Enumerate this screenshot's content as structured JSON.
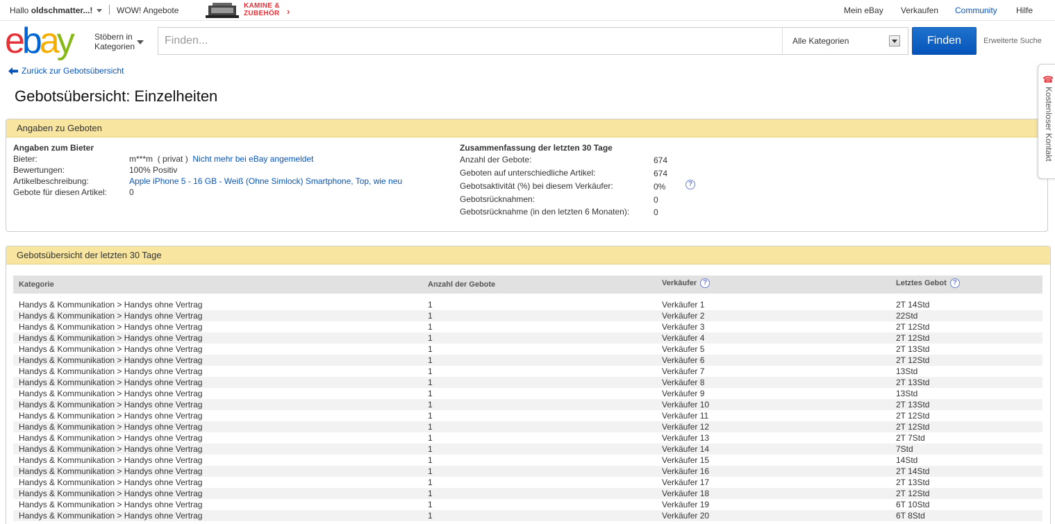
{
  "topbar": {
    "greeting_prefix": "Hallo ",
    "username": "oldschmatter...!",
    "wow": "WOW! Angebote",
    "promo_line1": "KAMINE &",
    "promo_line2": "ZUBEHÖR",
    "promo_arrow": "›",
    "my_ebay": "Mein eBay",
    "sell": "Verkaufen",
    "community": "Community",
    "help": "Hilfe"
  },
  "header": {
    "logo": [
      "e",
      "b",
      "a",
      "y"
    ],
    "logo_colors": [
      "#e53238",
      "#0064d2",
      "#f5af02",
      "#86b817"
    ],
    "browse_line1": "Stöbern in",
    "browse_line2": "Kategorien",
    "search_placeholder": "Finden...",
    "category": "Alle Kategorien",
    "find_button": "Finden",
    "advanced": "Erweiterte Suche"
  },
  "back_link": "Zurück zur Gebotsübersicht",
  "page_title": "Gebotsübersicht: Einzelheiten",
  "panel1": {
    "title": "Angaben zu Geboten",
    "bidder_header": "Angaben zum Bieter",
    "bidder_label": "Bieter:",
    "bidder_value": "m***m",
    "bidder_private": "( privat )",
    "bidder_status": "Nicht mehr bei eBay angemeldet",
    "ratings_label": "Bewertungen:",
    "ratings_value": "100% Positiv",
    "item_label": "Artikelbeschreibung:",
    "item_value": "Apple iPhone 5 - 16 GB - Weiß (Ohne Simlock) Smartphone, Top, wie neu",
    "bids_item_label": "Gebote für diesen Artikel:",
    "bids_item_value": "0",
    "summary_header": "Zusammenfassung der letzten 30 Tage",
    "summary": [
      {
        "label": "Anzahl der Gebote:",
        "value": "674"
      },
      {
        "label": "Geboten auf unterschiedliche Artikel:",
        "value": "674"
      },
      {
        "label": "Gebotsaktivität (%) bei diesem Verkäufer:",
        "value": "0%"
      },
      {
        "label": "Gebotsrücknahmen:",
        "value": "0"
      },
      {
        "label": "Gebotsrücknahme (in den letzten 6 Monaten):",
        "value": "0"
      }
    ]
  },
  "panel2": {
    "title": "Gebotsübersicht der letzten 30 Tage",
    "columns": [
      "Kategorie",
      "Anzahl der Gebote",
      "Verkäufer",
      "Letztes Gebot"
    ],
    "help_glyph": "?",
    "rows": [
      [
        "Handys & Kommunikation > Handys ohne Vertrag",
        "1",
        "Verkäufer 1",
        "2T 14Std"
      ],
      [
        "Handys & Kommunikation > Handys ohne Vertrag",
        "1",
        "Verkäufer 2",
        "22Std"
      ],
      [
        "Handys & Kommunikation > Handys ohne Vertrag",
        "1",
        "Verkäufer 3",
        "2T 12Std"
      ],
      [
        "Handys & Kommunikation > Handys ohne Vertrag",
        "1",
        "Verkäufer 4",
        "2T 12Std"
      ],
      [
        "Handys & Kommunikation > Handys ohne Vertrag",
        "1",
        "Verkäufer 5",
        "2T 13Std"
      ],
      [
        "Handys & Kommunikation > Handys ohne Vertrag",
        "1",
        "Verkäufer 6",
        "2T 12Std"
      ],
      [
        "Handys & Kommunikation > Handys ohne Vertrag",
        "1",
        "Verkäufer 7",
        "13Std"
      ],
      [
        "Handys & Kommunikation > Handys ohne Vertrag",
        "1",
        "Verkäufer 8",
        "2T 13Std"
      ],
      [
        "Handys & Kommunikation > Handys ohne Vertrag",
        "1",
        "Verkäufer 9",
        "13Std"
      ],
      [
        "Handys & Kommunikation > Handys ohne Vertrag",
        "1",
        "Verkäufer 10",
        "2T 13Std"
      ],
      [
        "Handys & Kommunikation > Handys ohne Vertrag",
        "1",
        "Verkäufer 11",
        "2T 12Std"
      ],
      [
        "Handys & Kommunikation > Handys ohne Vertrag",
        "1",
        "Verkäufer 12",
        "2T 12Std"
      ],
      [
        "Handys & Kommunikation > Handys ohne Vertrag",
        "1",
        "Verkäufer 13",
        "2T 7Std"
      ],
      [
        "Handys & Kommunikation > Handys ohne Vertrag",
        "1",
        "Verkäufer 14",
        "7Std"
      ],
      [
        "Handys & Kommunikation > Handys ohne Vertrag",
        "1",
        "Verkäufer 15",
        "14Std"
      ],
      [
        "Handys & Kommunikation > Handys ohne Vertrag",
        "1",
        "Verkäufer 16",
        "2T 14Std"
      ],
      [
        "Handys & Kommunikation > Handys ohne Vertrag",
        "1",
        "Verkäufer 17",
        "2T 13Std"
      ],
      [
        "Handys & Kommunikation > Handys ohne Vertrag",
        "1",
        "Verkäufer 18",
        "2T 12Std"
      ],
      [
        "Handys & Kommunikation > Handys ohne Vertrag",
        "1",
        "Verkäufer 19",
        "6T 10Std"
      ],
      [
        "Handys & Kommunikation > Handys ohne Vertrag",
        "1",
        "Verkäufer 20",
        "6T 8Std"
      ]
    ]
  },
  "side_tab": {
    "label": "Kostenloser Kontakt",
    "icon": "phone-icon"
  }
}
